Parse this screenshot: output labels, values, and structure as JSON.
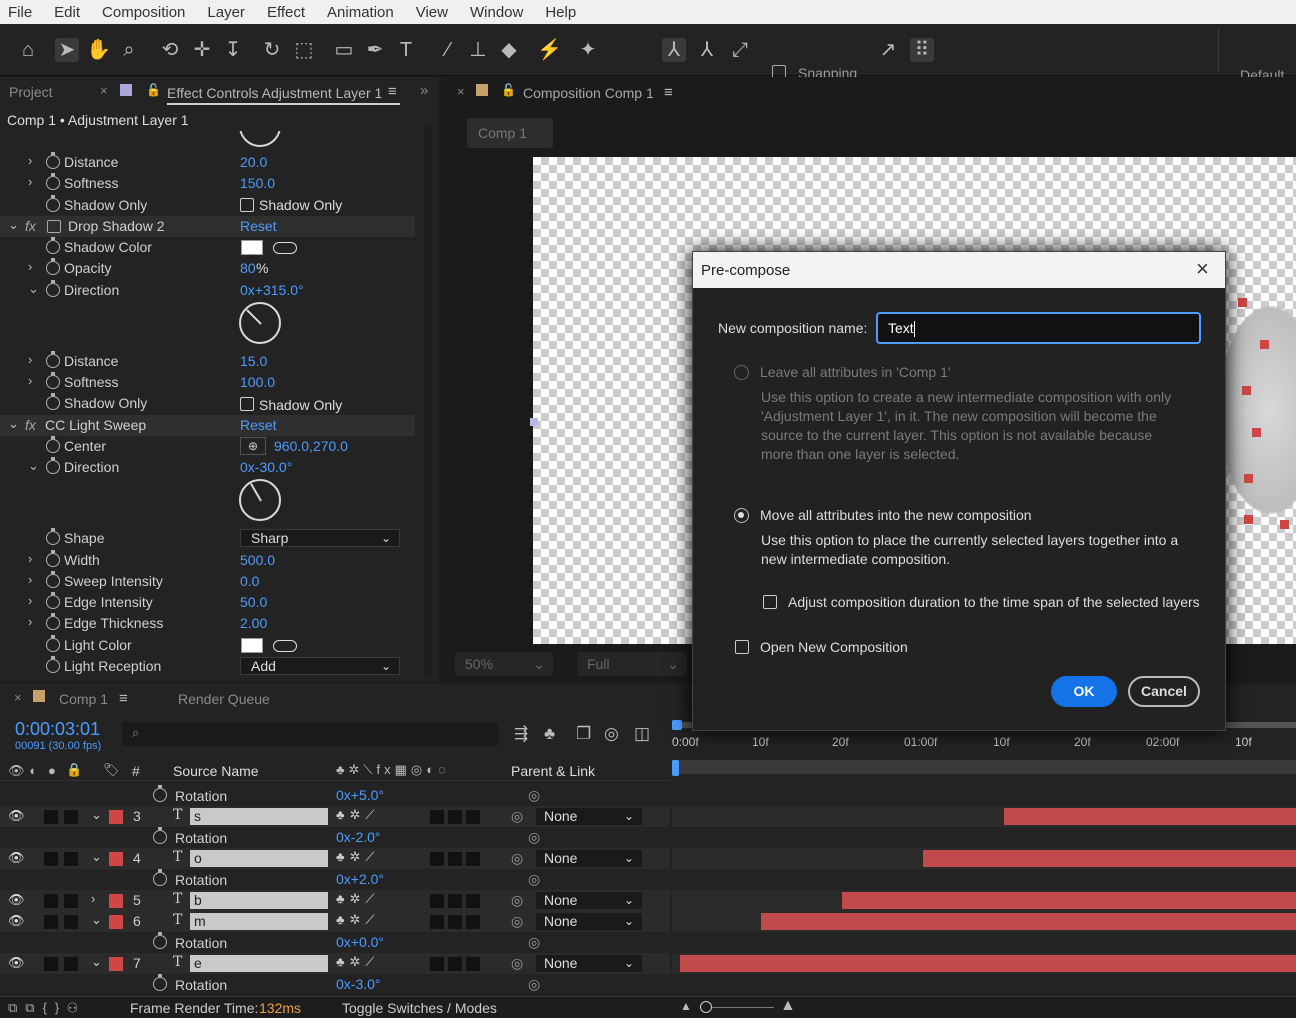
{
  "menu": [
    "File",
    "Edit",
    "Composition",
    "Layer",
    "Effect",
    "Animation",
    "View",
    "Window",
    "Help"
  ],
  "toolbar": {
    "snapping": "Snapping",
    "workspace": "Default"
  },
  "left_panel": {
    "tab_project": "Project",
    "tab_effect_controls": "Effect Controls Adjustment Layer 1",
    "subtitle": "Comp 1 • Adjustment Layer 1",
    "distance1": {
      "label": "Distance",
      "value": "20.0"
    },
    "softness1": {
      "label": "Softness",
      "value": "150.0"
    },
    "shadow_only1": {
      "label": "Shadow Only",
      "cb": "Shadow Only"
    },
    "drop_shadow2": {
      "label": "Drop Shadow 2",
      "reset": "Reset"
    },
    "shadow_color": {
      "label": "Shadow Color"
    },
    "opacity": {
      "label": "Opacity",
      "value": "80",
      "unit": "%"
    },
    "direction1": {
      "label": "Direction",
      "value": "0x+315.0°",
      "angle": 315
    },
    "distance2": {
      "label": "Distance",
      "value": "15.0"
    },
    "softness2": {
      "label": "Softness",
      "value": "100.0"
    },
    "shadow_only2": {
      "label": "Shadow Only",
      "cb": "Shadow Only"
    },
    "light_sweep": {
      "label": "CC Light Sweep",
      "reset": "Reset"
    },
    "center": {
      "label": "Center",
      "value": "960.0,270.0"
    },
    "direction2": {
      "label": "Direction",
      "value": "0x-30.0°",
      "angle": -30
    },
    "shape": {
      "label": "Shape",
      "value": "Sharp"
    },
    "width": {
      "label": "Width",
      "value": "500.0"
    },
    "sweep_intensity": {
      "label": "Sweep Intensity",
      "value": "0.0"
    },
    "edge_intensity": {
      "label": "Edge Intensity",
      "value": "50.0"
    },
    "edge_thickness": {
      "label": "Edge Thickness",
      "value": "2.00"
    },
    "light_color": {
      "label": "Light Color"
    },
    "light_reception": {
      "label": "Light Reception",
      "value": "Add"
    }
  },
  "comp_panel": {
    "tab": "Composition Comp 1",
    "breadcrumb": "Comp 1",
    "zoom": "50%",
    "resolution": "Full"
  },
  "dialog": {
    "title": "Pre-compose",
    "name_label": "New composition name:",
    "name_value": "Text",
    "opt1_label": "Leave all attributes in 'Comp 1'",
    "opt1_desc": "Use this option to create a new intermediate composition with only 'Adjustment Layer 1', in it. The new composition will become the source to the current layer. This option is not available because more than one layer is selected.",
    "opt2_label": "Move all attributes into the new composition",
    "opt2_desc": "Use this option to place the currently selected layers together into a new intermediate composition.",
    "adjust_label": "Adjust composition duration to the time span of the selected layers",
    "open_label": "Open New Composition",
    "ok": "OK",
    "cancel": "Cancel"
  },
  "timeline": {
    "tab_comp": "Comp 1",
    "tab_render": "Render Queue",
    "timecode": "0:00:03:01",
    "frames": "00091 (30.00 fps)",
    "col_num": "#",
    "col_source": "Source Name",
    "col_parent": "Parent & Link",
    "ruler": [
      "0:00f",
      "10f",
      "20f",
      "01:00f",
      "10f",
      "20f",
      "02:00f",
      "10f"
    ],
    "rotation_label": "Rotation",
    "rot_top": "0x+5.0°",
    "layers": [
      {
        "num": "3",
        "name": "s",
        "parent": "None",
        "rot": "0x-2.0°",
        "bar_start_pct": 0.532
      },
      {
        "num": "4",
        "name": "o",
        "parent": "None",
        "rot": "0x+2.0°",
        "bar_start_pct": 0.402
      },
      {
        "num": "5",
        "name": "b",
        "parent": "None",
        "bar_start_pct": 0.272
      },
      {
        "num": "6",
        "name": "m",
        "parent": "None",
        "rot": "0x+0.0°",
        "bar_start_pct": 0.142
      },
      {
        "num": "7",
        "name": "e",
        "parent": "None",
        "rot": "0x-3.0°",
        "bar_start_pct": 0.013
      }
    ],
    "frame_render_label": "Frame Render Time:",
    "frame_render_value": "132ms",
    "toggle": "Toggle Switches / Modes"
  }
}
